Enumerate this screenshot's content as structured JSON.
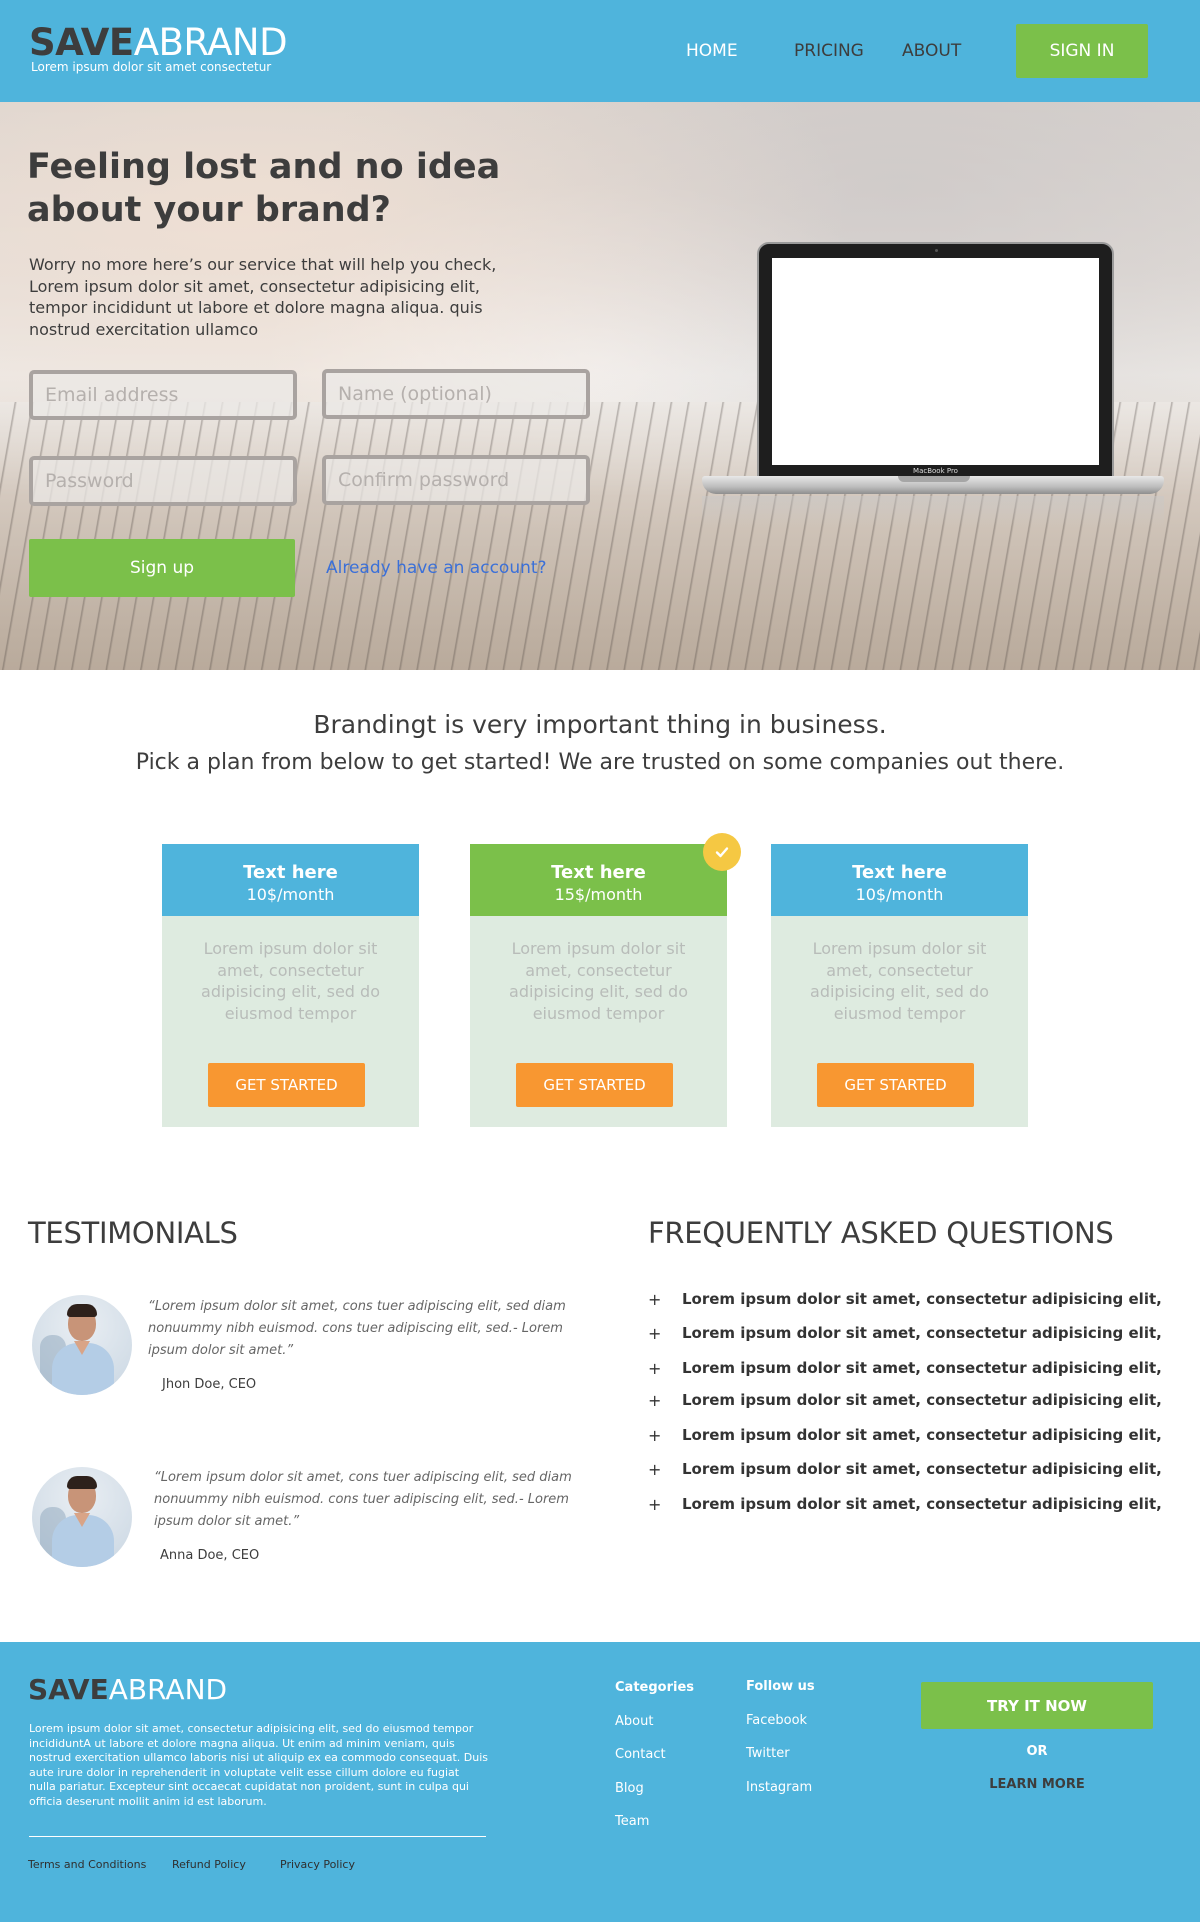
{
  "header": {
    "logo_bold": "SAVE",
    "logo_light": "ABRAND",
    "tagline": "Lorem ipsum dolor sit amet consectetur",
    "nav": [
      "HOME",
      "PRICING",
      "ABOUT"
    ],
    "sign_in": "SIGN IN"
  },
  "hero": {
    "title": "Feeling lost and no idea about your brand?",
    "description": "Worry no more here’s our service that will help you check, Lorem ipsum dolor sit amet, consectetur adipisicing elit, tempor incididunt ut labore et dolore magna aliqua. quis nostrud exercitation ullamco",
    "email_placeholder": "Email address",
    "name_placeholder": "Name (optional)",
    "password_placeholder": "Password",
    "confirm_placeholder": "Confirm password",
    "signup_button": "Sign up",
    "have_account_link": "Already have an account?",
    "laptop_label": "MacBook Pro"
  },
  "intro": {
    "line1": "Brandingt is very important thing in business.",
    "line2": "Pick a plan from below to get started! We are trusted on some companies out there."
  },
  "plans": [
    {
      "name": "Text here",
      "price": "10$/month",
      "description": "Lorem ipsum dolor sit amet, consectetur adipisicing elit, sed do eiusmod tempor",
      "button": "GET STARTED"
    },
    {
      "name": "Text here",
      "price": "15$/month",
      "description": "Lorem ipsum dolor sit amet, consectetur adipisicing elit, sed do eiusmod tempor",
      "button": "GET STARTED"
    },
    {
      "name": "Text here",
      "price": "10$/month",
      "description": "Lorem ipsum dolor sit amet, consectetur adipisicing elit, sed do eiusmod tempor",
      "button": "GET STARTED"
    }
  ],
  "testimonials": {
    "title": "TESTIMONIALS",
    "items": [
      {
        "quote": "“Lorem ipsum dolor sit amet, cons tuer adipiscing elit, sed diam nonuummy nibh euismod. cons tuer adipiscing elit, sed.- Lorem ipsum dolor sit amet.”",
        "author": "Jhon Doe, CEO"
      },
      {
        "quote": "“Lorem ipsum dolor sit amet, cons tuer adipiscing elit, sed diam nonuummy nibh euismod. cons tuer adipiscing elit, sed.- Lorem ipsum dolor sit amet.”",
        "author": "Anna Doe, CEO"
      }
    ]
  },
  "faq": {
    "title": "FREQUENTLY ASKED QUESTIONS",
    "plus": "+",
    "items": [
      "Lorem ipsum dolor sit amet, consectetur adipisicing elit,",
      "Lorem ipsum dolor sit amet, consectetur adipisicing elit,",
      "Lorem ipsum dolor sit amet, consectetur adipisicing elit,",
      "Lorem ipsum dolor sit amet, consectetur adipisicing elit,",
      "Lorem ipsum dolor sit amet, consectetur adipisicing elit,",
      "Lorem ipsum dolor sit amet, consectetur adipisicing elit,",
      "Lorem ipsum dolor sit amet, consectetur adipisicing elit,"
    ]
  },
  "footer": {
    "logo_bold": "SAVE",
    "logo_light": "ABRAND",
    "about": "Lorem ipsum dolor sit amet, consectetur adipisicing elit, sed do eiusmod tempor incididuntA ut labore et dolore magna aliqua. Ut enim ad minim veniam, quis nostrud exercitation ullamco laboris nisi ut aliquip ex ea commodo consequat. Duis aute irure dolor in reprehenderit in voluptate velit esse cillum dolore eu fugiat nulla pariatur. Excepteur sint occaecat cupidatat non proident, sunt in culpa qui officia deserunt mollit anim id est laborum.",
    "links": [
      "Terms and Conditions",
      "Refund Policy",
      "Privacy Policy"
    ],
    "categories_title": "Categories",
    "categories": [
      "About",
      "Contact",
      "Blog",
      "Team"
    ],
    "follow_title": "Follow us",
    "follow": [
      "Facebook",
      "Twitter",
      "Instagram"
    ],
    "try_button": "TRY IT NOW",
    "or": "OR",
    "learn_more": "LEARN MORE"
  },
  "colors": {
    "primary_blue": "#4fb4dc",
    "green": "#7bc04a",
    "orange": "#f89731",
    "badge_yellow": "#f5c843",
    "link_blue": "#3b70d8"
  },
  "icons": {
    "featured_badge": "check-icon",
    "faq_marker": "plus-icon"
  }
}
